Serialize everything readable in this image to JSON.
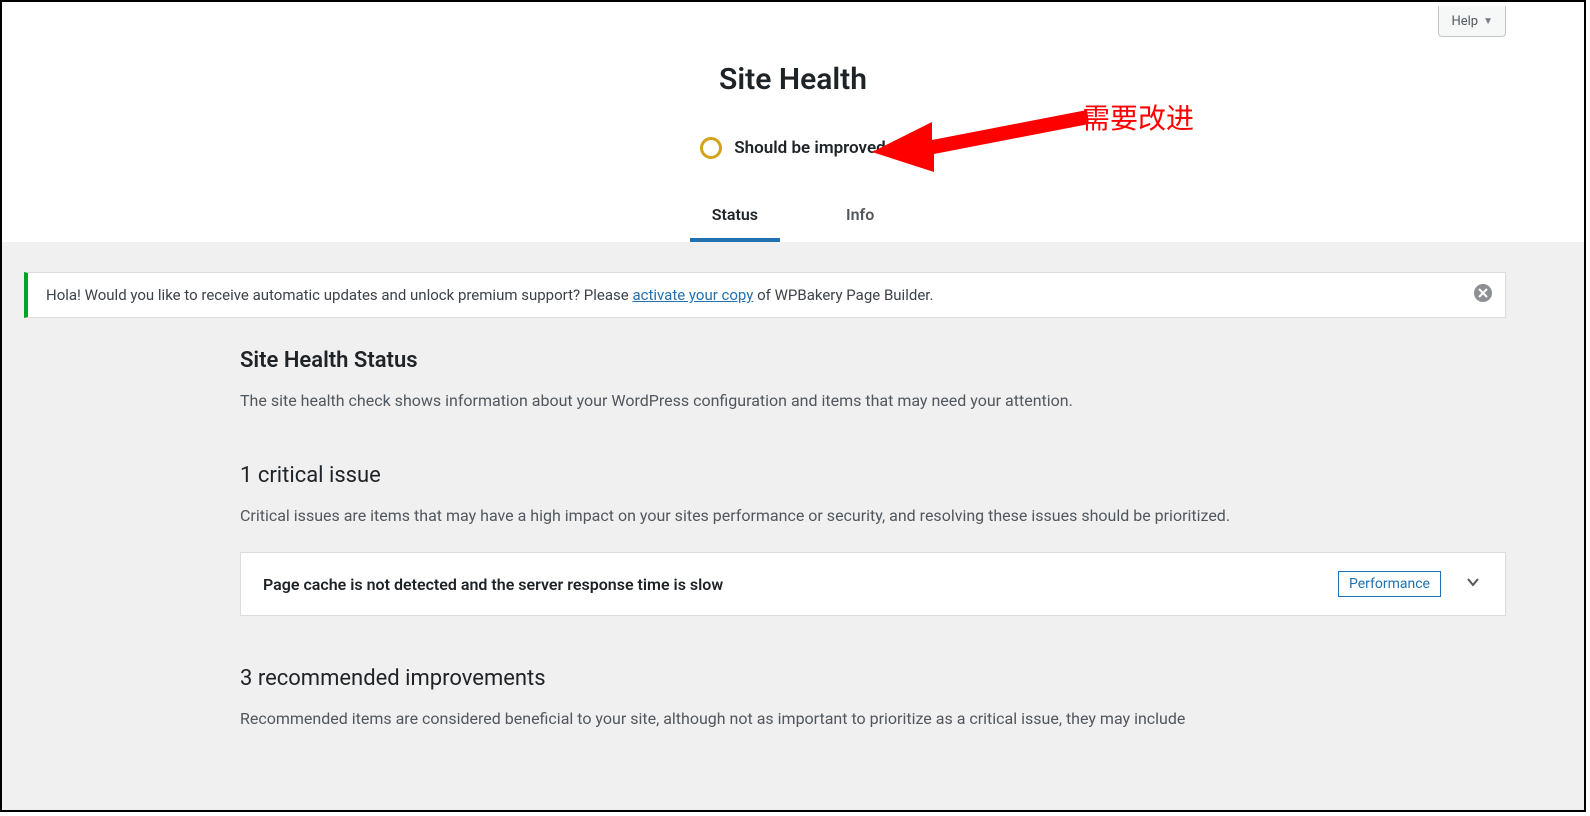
{
  "help_label": "Help",
  "page_title": "Site Health",
  "status_text": "Should be improved",
  "annotation_text": "需要改进",
  "tabs": {
    "status": "Status",
    "info": "Info"
  },
  "notice": {
    "prefix": "Hola! Would you like to receive automatic updates and unlock premium support? Please ",
    "link": "activate your copy",
    "suffix": " of WPBakery Page Builder."
  },
  "section": {
    "title": "Site Health Status",
    "desc": "The site health check shows information about your WordPress configuration and items that may need your attention."
  },
  "critical": {
    "title": "1 critical issue",
    "desc": "Critical issues are items that may have a high impact on your sites performance or security, and resolving these issues should be prioritized.",
    "issue_title": "Page cache is not detected and the server response time is slow",
    "badge": "Performance"
  },
  "recommended": {
    "title": "3 recommended improvements",
    "desc": "Recommended items are considered beneficial to your site, although not as important to prioritize as a critical issue, they may include"
  }
}
